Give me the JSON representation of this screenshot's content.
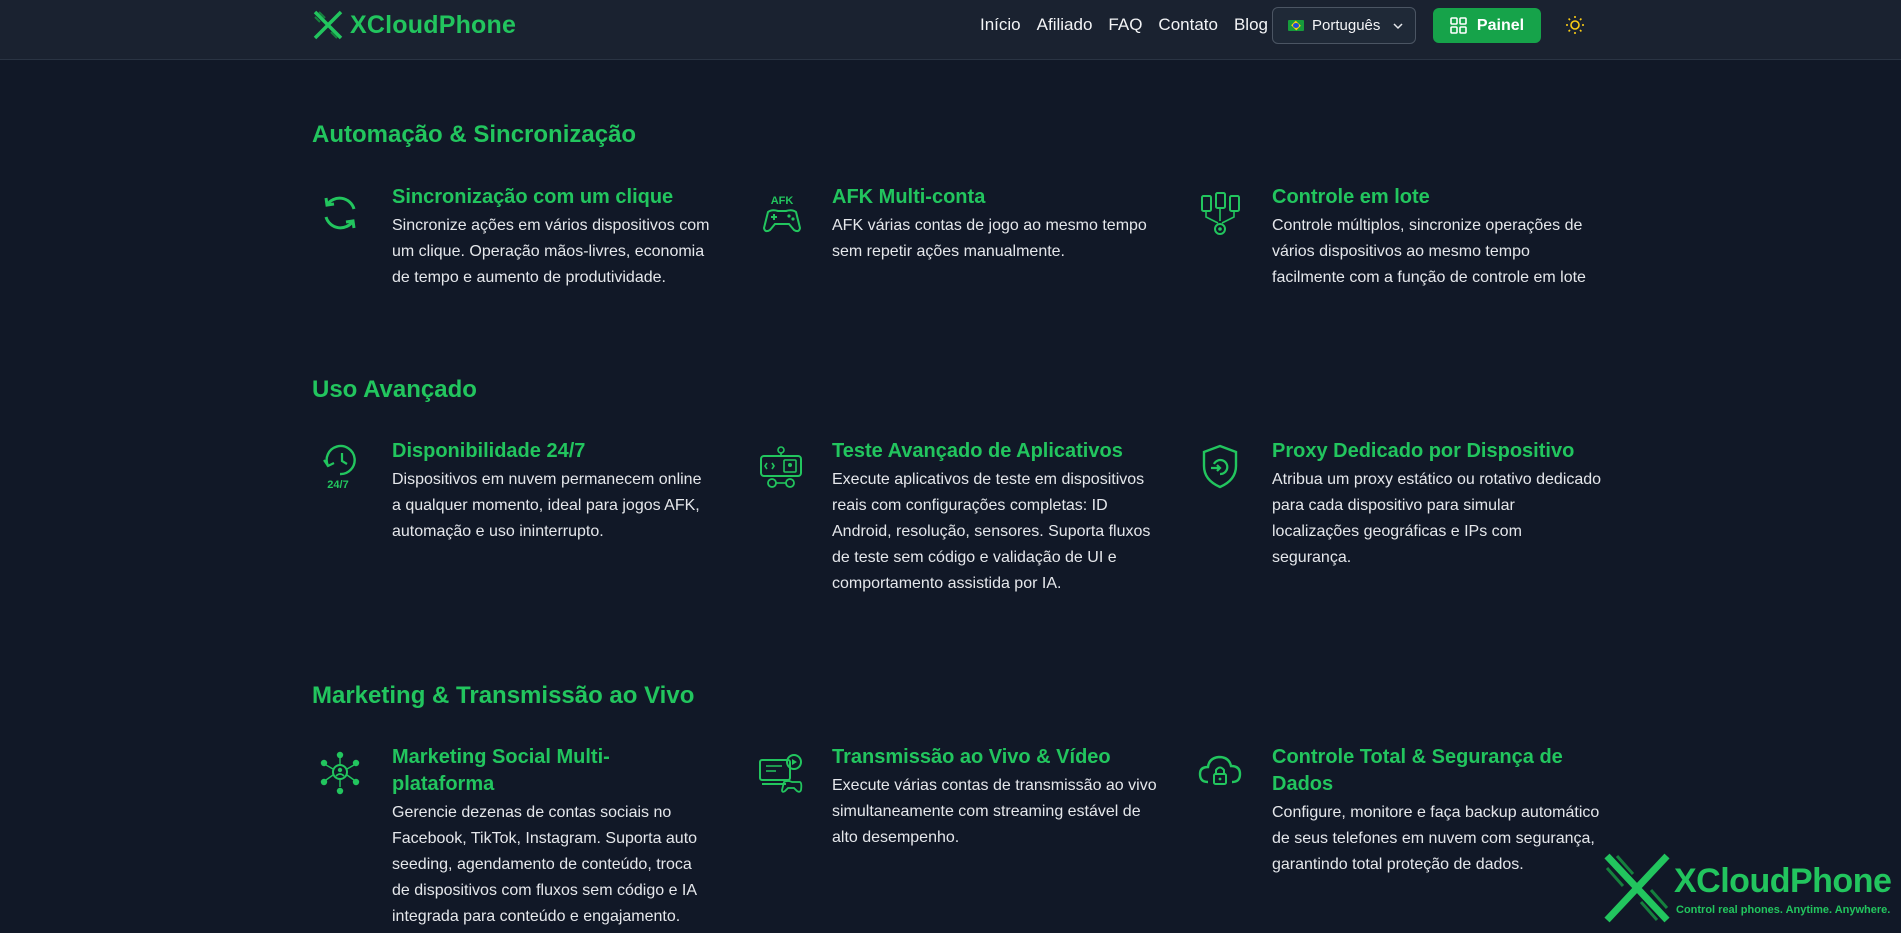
{
  "brand": {
    "name": "XCloudPhone",
    "accent": "#22c55e"
  },
  "nav": {
    "links": [
      "Início",
      "Afiliado",
      "FAQ",
      "Contato",
      "Blog"
    ],
    "language": "Português",
    "panel_button": "Painel"
  },
  "sections": [
    {
      "title": "Automação & Sincronização",
      "features": [
        {
          "icon": "sync-icon",
          "title": "Sincronização com um clique",
          "desc": "Sincronize ações em vários dispositivos com um clique. Operação mãos-livres, economia de tempo e aumento de produtividade."
        },
        {
          "icon": "gamepad-afk-icon",
          "title": "AFK Multi-conta",
          "desc": "AFK várias contas de jogo ao mesmo tempo sem repetir ações manualmente."
        },
        {
          "icon": "batch-devices-icon",
          "title": "Controle em lote",
          "desc": "Controle múltiplos, sincronize operações de vários dispositivos ao mesmo tempo facilmente com a função de controle em lote"
        }
      ]
    },
    {
      "title": "Uso Avançado",
      "features": [
        {
          "icon": "clock-24-7-icon",
          "title": "Disponibilidade 24/7",
          "desc": "Dispositivos em nuvem permanecem online a qualquer momento, ideal para jogos AFK, automação e uso ininterrupto."
        },
        {
          "icon": "app-test-icon",
          "title": "Teste Avançado de Aplicativos",
          "desc": "Execute aplicativos de teste em dispositivos reais com configurações completas: ID Android, resolução, sensores. Suporta fluxos de teste sem código e validação de UI e comportamento assistida por IA."
        },
        {
          "icon": "shield-proxy-icon",
          "title": "Proxy Dedicado por Dispositivo",
          "desc": "Atribua um proxy estático ou rotativo dedicado para cada dispositivo para simular localizações geográficas e IPs com segurança."
        }
      ]
    },
    {
      "title": "Marketing & Transmissão ao Vivo",
      "features": [
        {
          "icon": "social-network-icon",
          "title": "Marketing Social Multi-plataforma",
          "desc": "Gerencie dezenas de contas sociais no Facebook, TikTok, Instagram. Suporta auto seeding, agendamento de conteúdo, troca de dispositivos com fluxos sem código e IA integrada para conteúdo e engajamento."
        },
        {
          "icon": "live-stream-icon",
          "title": "Transmissão ao Vivo & Vídeo",
          "desc": "Execute várias contas de transmissão ao vivo simultaneamente com streaming estável de alto desempenho."
        },
        {
          "icon": "cloud-lock-icon",
          "title": "Controle Total & Segurança de Dados",
          "desc": "Configure, monitore e faça backup automático de seus telefones em nuvem com segurança, garantindo total proteção de dados."
        }
      ]
    }
  ],
  "watermark": {
    "name": "XCloudPhone",
    "tagline": "Control real phones. Anytime. Anywhere."
  }
}
